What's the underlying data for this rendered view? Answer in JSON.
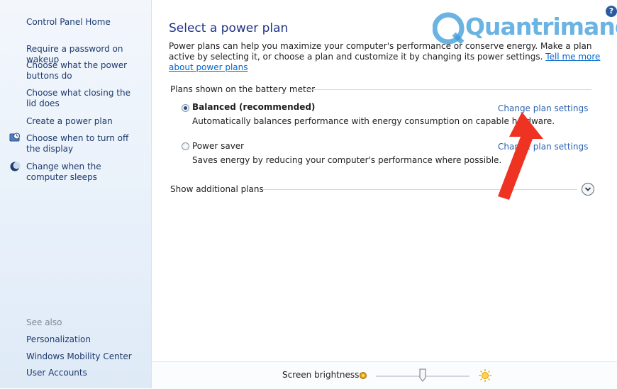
{
  "sidebar": {
    "home": "Control Panel Home",
    "links": [
      "Require a password on wakeup",
      "Choose what the power buttons do",
      "Choose what closing the lid does",
      "Create a power plan",
      "Choose when to turn off the display",
      "Change when the computer sleeps"
    ],
    "see_also_title": "See also",
    "see_also": [
      "Personalization",
      "Windows Mobility Center",
      "User Accounts"
    ]
  },
  "main": {
    "title": "Select a power plan",
    "description": "Power plans can help you maximize your computer's performance or conserve energy. Make a plan active by selecting it, or choose a plan and customize it by changing its power settings.",
    "learn_more": "Tell me more about power plans",
    "group_label": "Plans shown on the battery meter",
    "plans": [
      {
        "name": "Balanced (recommended)",
        "desc": "Automatically balances performance with energy consumption on capable hardware.",
        "link": "Change plan settings",
        "selected": true
      },
      {
        "name": "Power saver",
        "desc": "Saves energy by reducing your computer's performance where possible.",
        "link": "Change plan settings",
        "selected": false
      }
    ],
    "additional": "Show additional plans"
  },
  "bottom": {
    "brightness_label": "Screen brightness:",
    "brightness_level": 0.5
  },
  "watermark": "Quantrimang",
  "help": "?",
  "colors": {
    "arrow": "#ee3322",
    "link": "#2b62b2",
    "title": "#1e3287",
    "watermark": "#3a9ad9"
  }
}
